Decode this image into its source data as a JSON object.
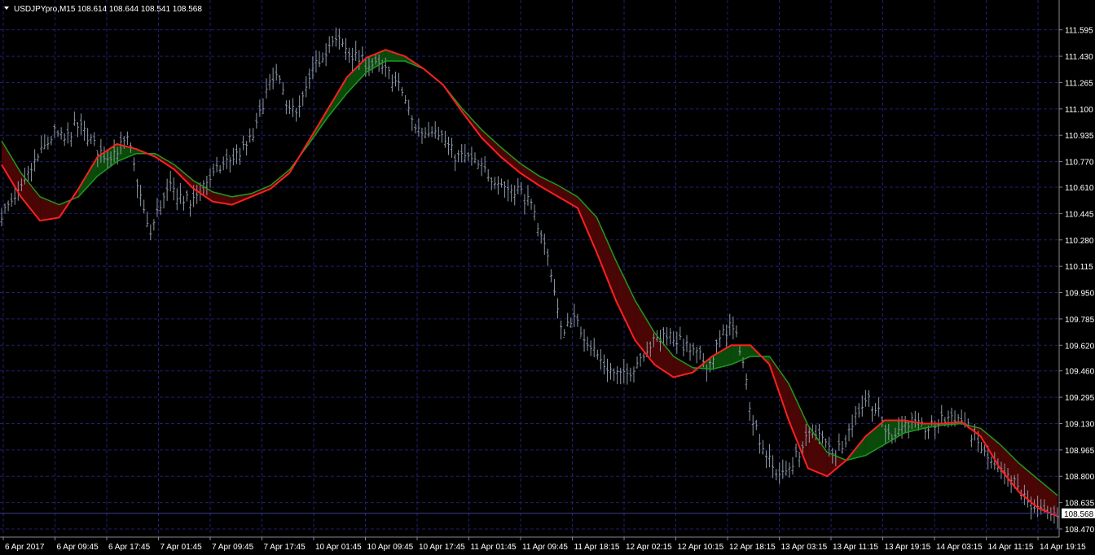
{
  "window": {
    "symbol_label": "USDJPYpro,M15",
    "ohlc_label": "108.614 108.644 108.541 108.568",
    "menu_icon": "triangle-down-icon"
  },
  "colors": {
    "background": "#000000",
    "grid": "#1f1f6f",
    "bars": "#8e9aa8",
    "fast_line": "#ff2020",
    "slow_line": "#1f9a1f",
    "bull_fill": "#0a4a0a",
    "bear_fill": "#4a0505",
    "axis_text": "#ffffff",
    "price_label_bg": "#ffffff",
    "price_label_text": "#000000"
  },
  "chart_data": {
    "type": "line",
    "title": "USDJPYpro,M15",
    "ylim": [
      108.47,
      111.68
    ],
    "y_ticks": [
      "111.595",
      "111.430",
      "111.265",
      "111.100",
      "110.935",
      "110.770",
      "110.610",
      "110.445",
      "110.280",
      "110.115",
      "109.950",
      "109.785",
      "109.620",
      "109.460",
      "109.295",
      "109.130",
      "108.965",
      "108.800",
      "108.635",
      "108.470"
    ],
    "current_price": "108.568",
    "x_ticks": [
      "6 Apr 2017",
      "6 Apr 09:45",
      "6 Apr 17:45",
      "7 Apr 01:45",
      "7 Apr 09:45",
      "7 Apr 17:45",
      "10 Apr 01:45",
      "10 Apr 09:45",
      "10 Apr 17:45",
      "11 Apr 01:45",
      "11 Apr 09:45",
      "11 Apr 18:15",
      "12 Apr 02:15",
      "12 Apr 10:15",
      "12 Apr 18:15",
      "13 Apr 03:15",
      "13 Apr 11:15",
      "13 Apr 19:15",
      "14 Apr 03:15",
      "14 Apr 11:15",
      "14 Apr 19:15"
    ],
    "grid": true,
    "price_series": [
      110.45,
      110.5,
      110.6,
      110.75,
      110.85,
      110.95,
      110.9,
      111.0,
      110.95,
      110.85,
      110.8,
      110.85,
      110.9,
      110.6,
      110.3,
      110.5,
      110.6,
      110.55,
      110.5,
      110.62,
      110.68,
      110.75,
      110.8,
      110.85,
      110.95,
      111.2,
      111.3,
      111.15,
      111.05,
      111.25,
      111.4,
      111.5,
      111.52,
      111.45,
      111.4,
      111.38,
      111.35,
      111.3,
      111.2,
      111.0,
      110.95,
      111.0,
      110.9,
      110.8,
      110.8,
      110.75,
      110.7,
      110.65,
      110.6,
      110.6,
      110.5,
      110.35,
      110.1,
      109.7,
      109.8,
      109.7,
      109.6,
      109.5,
      109.45,
      109.42,
      109.5,
      109.6,
      109.65,
      109.7,
      109.65,
      109.6,
      109.55,
      109.5,
      109.65,
      109.75,
      109.6,
      109.2,
      109.0,
      108.85,
      108.8,
      108.9,
      109.0,
      109.1,
      109.0,
      108.95,
      109.05,
      109.2,
      109.3,
      109.2,
      109.05,
      109.1,
      109.15,
      109.1,
      109.1,
      109.15,
      109.18,
      109.15,
      109.05,
      108.95,
      108.85,
      108.8,
      108.75,
      108.65,
      108.6,
      108.55,
      108.57
    ],
    "series": [
      {
        "name": "",
        "values": [
          110.75,
          110.55,
          110.4,
          110.42,
          110.6,
          110.8,
          110.88,
          110.85,
          110.8,
          110.72,
          110.6,
          110.52,
          110.5,
          110.55,
          110.6,
          110.7,
          110.9,
          111.1,
          111.3,
          111.42,
          111.47,
          111.43,
          111.35,
          111.25,
          111.08,
          110.92,
          110.8,
          110.7,
          110.62,
          110.55,
          110.48,
          110.2,
          109.9,
          109.65,
          109.5,
          109.42,
          109.45,
          109.55,
          109.62,
          109.62,
          109.5,
          109.15,
          108.85,
          108.8,
          108.9,
          109.05,
          109.15,
          109.15,
          109.13,
          109.13,
          109.14,
          109.05,
          108.85,
          108.7,
          108.6,
          108.55
        ]
      },
      {
        "name": "",
        "values": [
          110.9,
          110.7,
          110.55,
          110.5,
          110.55,
          110.68,
          110.77,
          110.82,
          110.82,
          110.75,
          110.65,
          110.58,
          110.55,
          110.57,
          110.62,
          110.72,
          110.88,
          111.05,
          111.2,
          111.33,
          111.4,
          111.4,
          111.35,
          111.25,
          111.1,
          110.97,
          110.86,
          110.76,
          110.68,
          110.62,
          110.55,
          110.42,
          110.15,
          109.9,
          109.7,
          109.55,
          109.48,
          109.47,
          109.5,
          109.55,
          109.55,
          109.38,
          109.12,
          108.95,
          108.9,
          108.93,
          109.0,
          109.07,
          109.1,
          109.12,
          109.13,
          109.1,
          109.0,
          108.88,
          108.78,
          108.68
        ]
      }
    ]
  }
}
